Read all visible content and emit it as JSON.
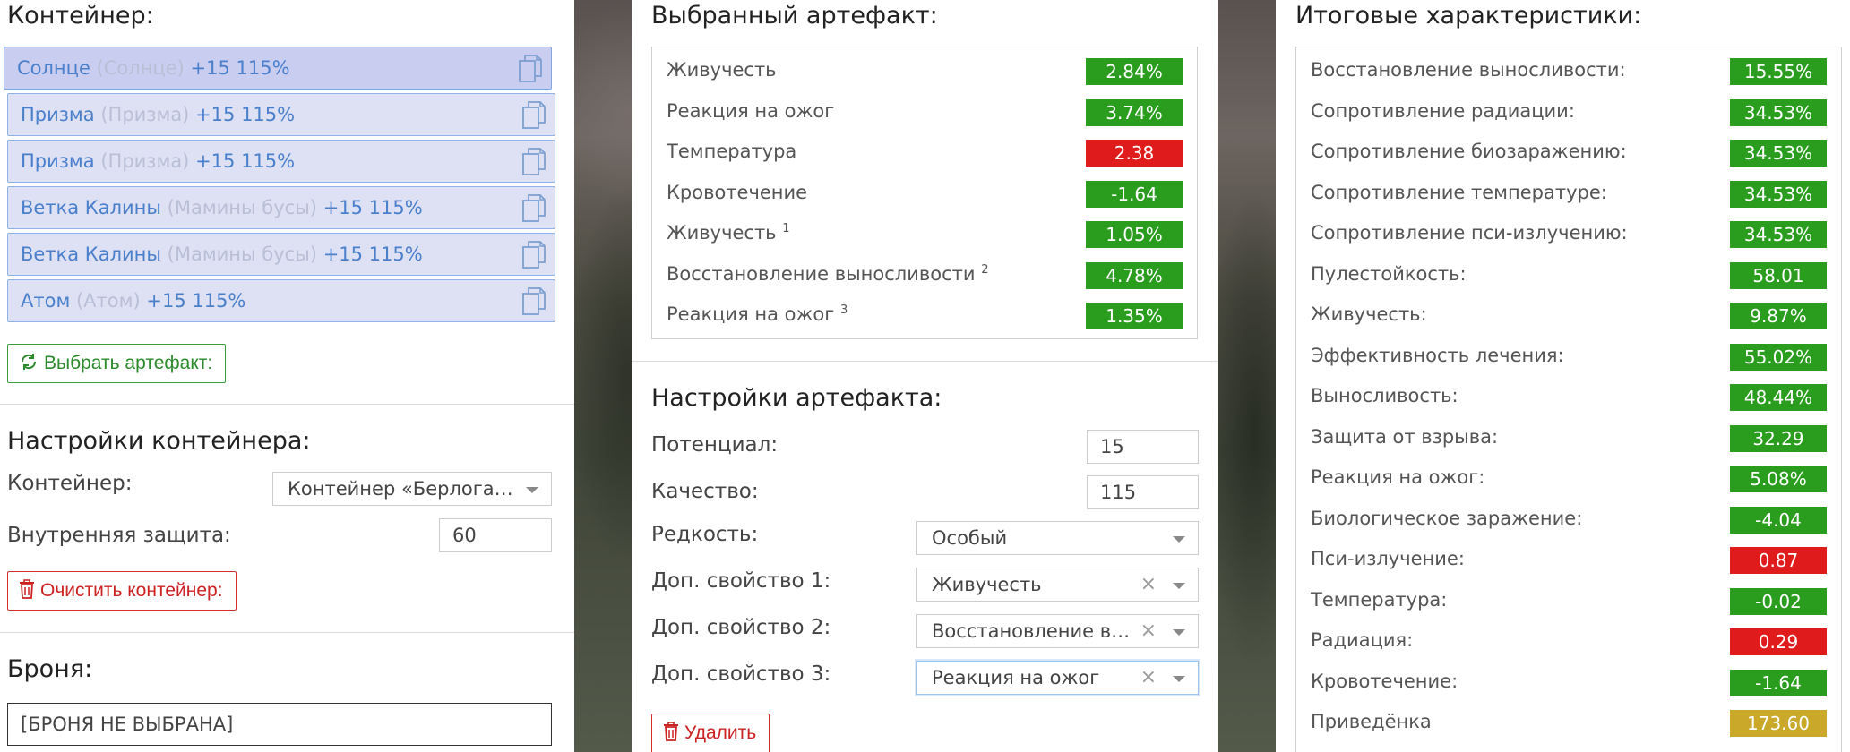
{
  "left": {
    "container_title": "Контейнер:",
    "items": [
      {
        "name": "Солнце",
        "alt": "(Солнце)",
        "bonus": "+15 115%"
      },
      {
        "name": "Призма",
        "alt": "(Призма)",
        "bonus": "+15 115%"
      },
      {
        "name": "Призма",
        "alt": "(Призма)",
        "bonus": "+15 115%"
      },
      {
        "name": "Ветка Калины",
        "alt": "(Мамины бусы)",
        "bonus": "+15 115%"
      },
      {
        "name": "Ветка Калины",
        "alt": "(Мамины бусы)",
        "bonus": "+15 115%"
      },
      {
        "name": "Атом",
        "alt": "(Атом)",
        "bonus": "+15 115%"
      }
    ],
    "select_artifact_label": "Выбрать артефакт:",
    "settings_title": "Настройки контейнера:",
    "container_label": "Контейнер:",
    "container_value": "Контейнер «Берлога…",
    "inner_protection_label": "Внутренняя защита:",
    "inner_protection_value": "60",
    "clear_label": "Очистить контейнер:",
    "armor_title": "Броня:",
    "armor_value": "[БРОНЯ НЕ ВЫБРАНА]"
  },
  "mid": {
    "selected_title": "Выбранный артефакт:",
    "stats": [
      {
        "name": "Живучесть",
        "sup": "",
        "value": "2.84%",
        "color": "green"
      },
      {
        "name": "Реакция на ожог",
        "sup": "",
        "value": "3.74%",
        "color": "green"
      },
      {
        "name": "Температура",
        "sup": "",
        "value": "2.38",
        "color": "red"
      },
      {
        "name": "Кровотечение",
        "sup": "",
        "value": "-1.64",
        "color": "green"
      },
      {
        "name": "Живучесть",
        "sup": "1",
        "value": "1.05%",
        "color": "green"
      },
      {
        "name": "Восстановление выносливости",
        "sup": "2",
        "value": "4.78%",
        "color": "green"
      },
      {
        "name": "Реакция на ожог",
        "sup": "3",
        "value": "1.35%",
        "color": "green"
      }
    ],
    "settings_title": "Настройки артефакта:",
    "potential_label": "Потенциал:",
    "potential_value": "15",
    "quality_label": "Качество:",
    "quality_value": "115",
    "rarity_label": "Редкость:",
    "rarity_value": "Особый",
    "extra1_label": "Доп. свойство 1:",
    "extra1_value": "Живучесть",
    "extra2_label": "Доп. свойство 2:",
    "extra2_value": "Восстановление в…",
    "extra3_label": "Доп. свойство 3:",
    "extra3_value": "Реакция на ожог",
    "clear_glyph": "×",
    "delete_label": "Удалить"
  },
  "right": {
    "title": "Итоговые характеристики:",
    "stats": [
      {
        "name": "Восстановление выносливости:",
        "value": "15.55%",
        "color": "green"
      },
      {
        "name": "Сопротивление радиации:",
        "value": "34.53%",
        "color": "green"
      },
      {
        "name": "Сопротивление биозаражению:",
        "value": "34.53%",
        "color": "green"
      },
      {
        "name": "Сопротивление температуре:",
        "value": "34.53%",
        "color": "green"
      },
      {
        "name": "Сопротивление пси-излучению:",
        "value": "34.53%",
        "color": "green"
      },
      {
        "name": "Пулестойкость:",
        "value": "58.01",
        "color": "green"
      },
      {
        "name": "Живучесть:",
        "value": "9.87%",
        "color": "green"
      },
      {
        "name": "Эффективность лечения:",
        "value": "55.02%",
        "color": "green"
      },
      {
        "name": "Выносливость:",
        "value": "48.44%",
        "color": "green"
      },
      {
        "name": "Защита от взрыва:",
        "value": "32.29",
        "color": "green"
      },
      {
        "name": "Реакция на ожог:",
        "value": "5.08%",
        "color": "green"
      },
      {
        "name": "Биологическое заражение:",
        "value": "-4.04",
        "color": "green"
      },
      {
        "name": "Пси-излучение:",
        "value": "0.87",
        "color": "red"
      },
      {
        "name": "Температура:",
        "value": "-0.02",
        "color": "green"
      },
      {
        "name": "Радиация:",
        "value": "0.29",
        "color": "red"
      },
      {
        "name": "Кровотечение:",
        "value": "-1.64",
        "color": "green"
      },
      {
        "name": "Приведёнка",
        "value": "173.60",
        "color": "gold"
      }
    ]
  },
  "colors": {
    "green": "#2a9d1f",
    "red": "#e01b1b",
    "gold": "#c9a82a",
    "link_blue": "#4a7fcc"
  }
}
